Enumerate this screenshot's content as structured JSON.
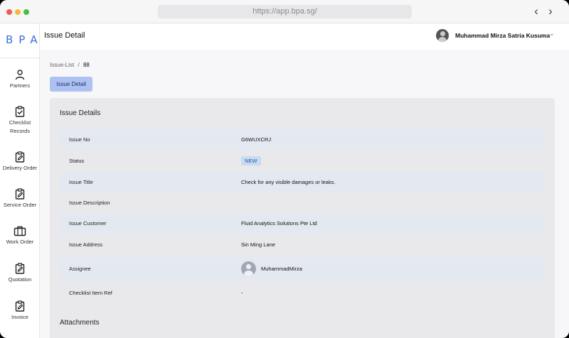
{
  "browser": {
    "url": "https://app.bpa.sg/"
  },
  "sidebar": {
    "logo": "BPA",
    "items": [
      {
        "label": "Partners",
        "icon": "person-icon"
      },
      {
        "label": "Checklist Records",
        "icon": "clipboard-check-icon"
      },
      {
        "label": "Delivery Order",
        "icon": "clipboard-edit-icon"
      },
      {
        "label": "Service Order",
        "icon": "clipboard-edit-icon"
      },
      {
        "label": "Work Order",
        "icon": "briefcase-icon"
      },
      {
        "label": "Quotation",
        "icon": "clipboard-edit-icon"
      },
      {
        "label": "Invoice",
        "icon": "clipboard-edit-icon"
      }
    ]
  },
  "header": {
    "title": "Issue Detail",
    "user_name": "Muhammad Mirza Satria Kusuma"
  },
  "breadcrumb": {
    "parent": "Issue-List",
    "separator": "/",
    "current": "88"
  },
  "tab": {
    "label": "Issue Detail"
  },
  "details": {
    "title": "Issue Details",
    "rows": [
      {
        "label": "Issue No",
        "value": "G6WUXCRJ"
      },
      {
        "label": "Status",
        "value": "NEW"
      },
      {
        "label": "Issue Title",
        "value": "Check for any visible damages or leaks."
      },
      {
        "label": "Issue Description",
        "value": ""
      },
      {
        "label": "Issue Customer",
        "value": "Fluid Analytics Solutions Pte Ltd"
      },
      {
        "label": "Issue Address",
        "value": "Sin Ming Lane"
      },
      {
        "label": "Assignee",
        "value": "MuhammadMirza"
      },
      {
        "label": "Checklist Item Ref",
        "value": "-"
      }
    ]
  },
  "attachments": {
    "title": "Attachments"
  },
  "colors": {
    "accent": "#aec2f2",
    "status_badge_bg": "#c7dbf3",
    "status_badge_text": "#2c5aa0"
  }
}
